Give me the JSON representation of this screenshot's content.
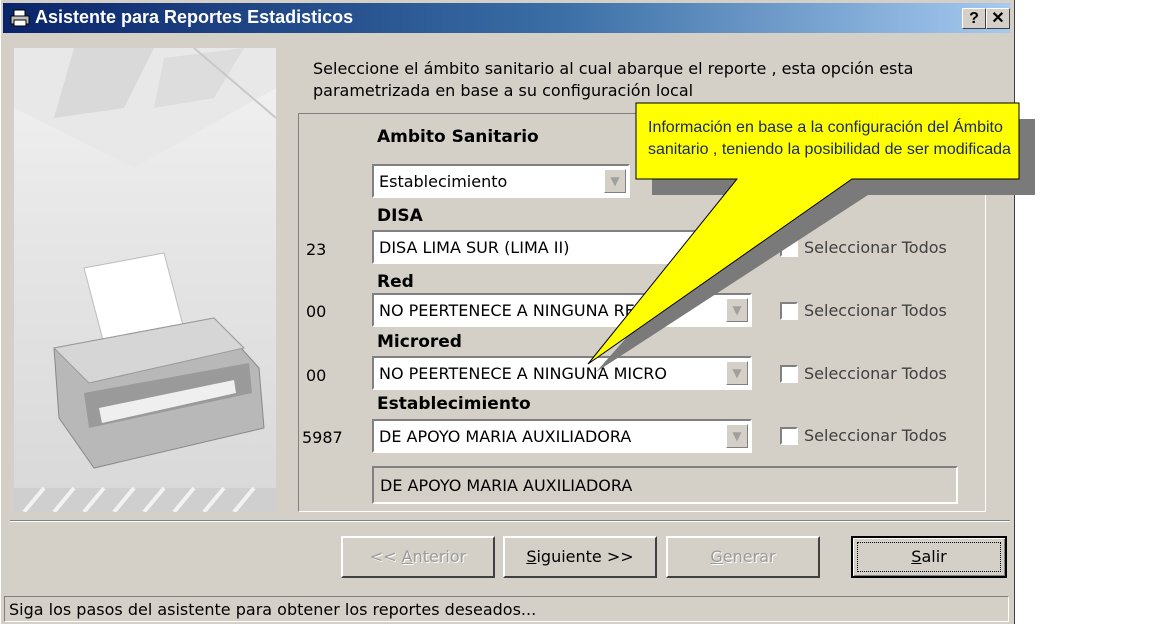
{
  "window": {
    "title": "Asistente para Reportes Estadisticos",
    "help_button": "?",
    "close_button": "✕"
  },
  "instructions": "Seleccione el  ámbito sanitario al cual abarque el reporte , esta opción esta parametrizada en base a su configuración local",
  "form": {
    "ambito_label": "Ambito Sanitario",
    "ambito_value": "Establecimiento",
    "disa": {
      "label": "DISA",
      "code": "23",
      "value": "DISA LIMA SUR (LIMA II)",
      "select_all": "Seleccionar Todos"
    },
    "red": {
      "label": "Red",
      "code": "00",
      "value": "NO PEERTENECE A NINGUNA RED",
      "select_all": "Seleccionar Todos"
    },
    "microred": {
      "label": "Microred",
      "code": "00",
      "value": "NO PEERTENECE A NINGUNA MICRO",
      "select_all": "Seleccionar Todos"
    },
    "establecimiento": {
      "label": "Establecimiento",
      "code": "5987",
      "value": "DE APOYO MARIA AUXILIADORA",
      "select_all": "Seleccionar Todos"
    },
    "establecimiento_name": "DE APOYO MARIA AUXILIADORA"
  },
  "buttons": {
    "prev": {
      "prefix": "<< ",
      "hotkey": "A",
      "rest": "nterior"
    },
    "next": {
      "hotkey": "S",
      "rest": "iguiente >>"
    },
    "generate": {
      "hotkey": "G",
      "rest": "enerar"
    },
    "exit": {
      "hotkey": "S",
      "rest": "alir"
    }
  },
  "callout": "Información en base a la configuración del Ámbito sanitario , teniendo la posibilidad de ser modificada",
  "status_bar": "Siga los pasos del asistente para obtener los reportes deseados...",
  "colors": {
    "title_start": "#0a246a",
    "title_end": "#a6caf0",
    "callout_fill": "#ffff00",
    "face": "#d4d0c8"
  },
  "icons": [
    "printer-icon",
    "help-icon",
    "close-icon",
    "dropdown-arrow-icon"
  ]
}
